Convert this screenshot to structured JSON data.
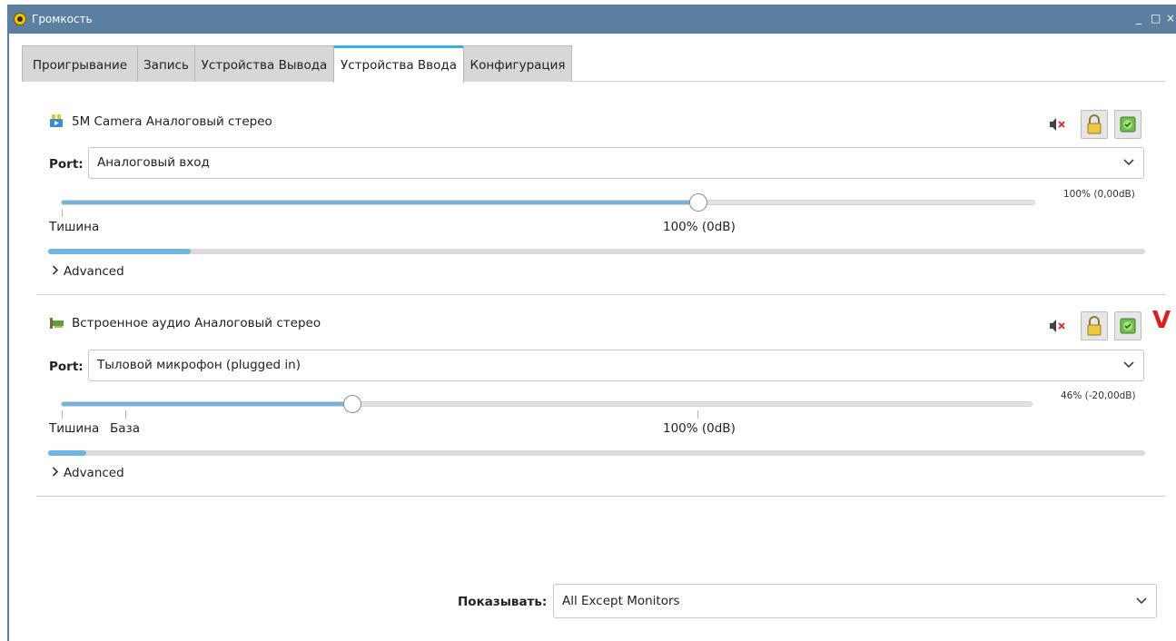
{
  "window": {
    "title": "Громкость",
    "minimize": "_",
    "maximize": "□",
    "close": "×"
  },
  "tabs": [
    {
      "label": "Проигрывание"
    },
    {
      "label": "Запись"
    },
    {
      "label": "Устройства Вывода"
    },
    {
      "label": "Устройства Ввода",
      "active": true
    },
    {
      "label": "Конфигурация"
    }
  ],
  "devices": [
    {
      "name": "5M Camera Аналоговый стерео",
      "icon": "webcam-icon",
      "port_label": "Port:",
      "port_value": "Аналоговый вход",
      "volume_fraction": 0.6545,
      "volume_readout": "100% (0,00dB)",
      "scale_labels": {
        "silence": "Тишина",
        "base": "",
        "max": "100% (0dB)"
      },
      "level_fraction": 0.13,
      "advanced": "Advanced"
    },
    {
      "name": "Встроенное аудио Аналоговый стерео",
      "icon": "sound-card-icon",
      "port_label": "Port:",
      "port_value": "Тыловой микрофон (plugged in)",
      "volume_fraction": 0.3,
      "volume_readout": "46% (-20,00dB)",
      "scale_labels": {
        "silence": "Тишина",
        "base": "База",
        "max": "100% (0dB)"
      },
      "level_fraction": 0.035,
      "advanced": "Advanced",
      "marker": "V"
    }
  ],
  "footer": {
    "show_label": "Показывать:",
    "show_value": "All Except Monitors"
  },
  "colors": {
    "titlebar": "#5a7fa1",
    "accent": "#3daee9",
    "slider_fill": "#6fb5e0",
    "marker": "#e01b1b"
  }
}
